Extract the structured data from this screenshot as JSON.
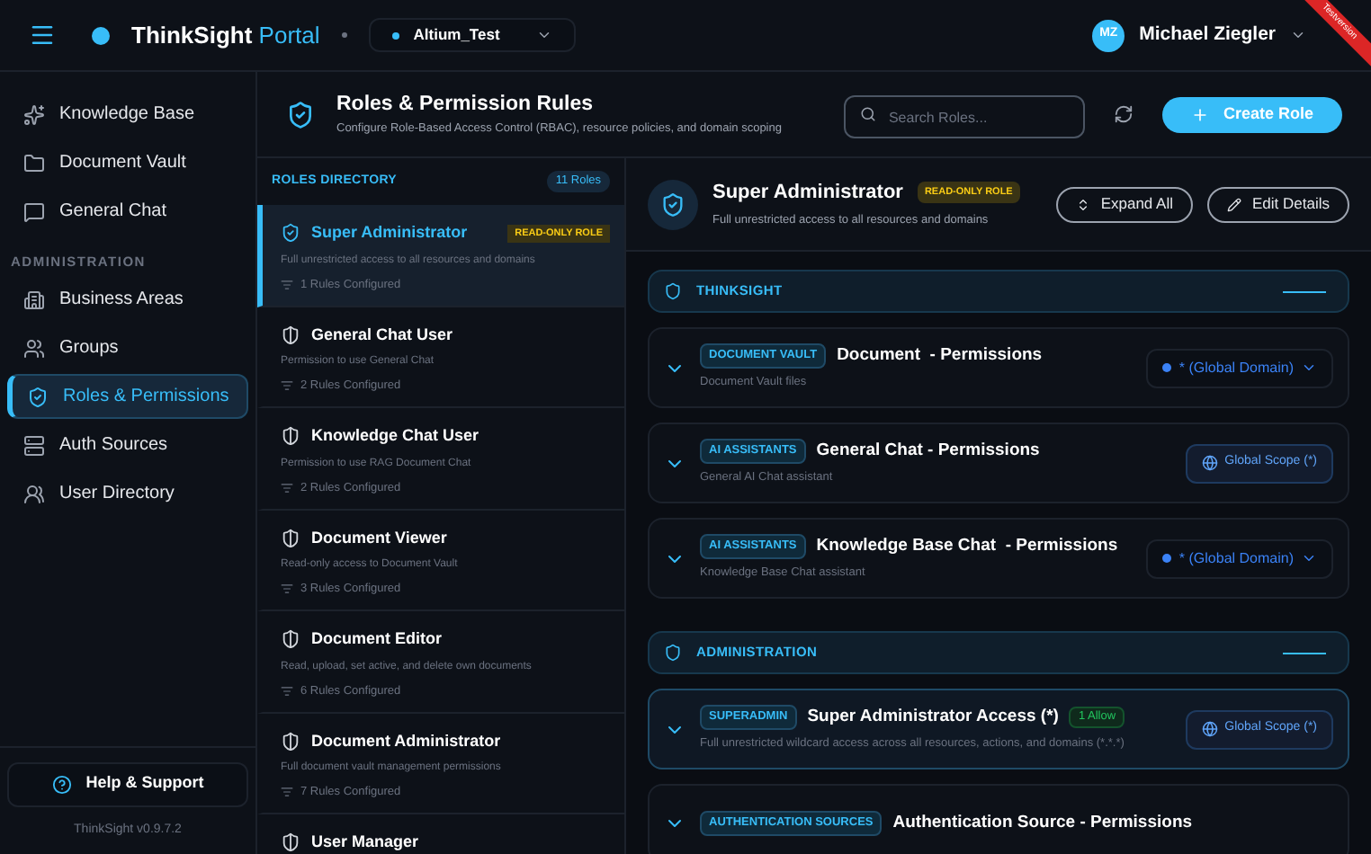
{
  "header": {
    "brand": "ThinkSight",
    "brand_accent": "Portal",
    "workspace": "Altium_Test",
    "user": {
      "initials": "MZ",
      "name": "Michael Ziegler"
    },
    "ribbon": "Testversion"
  },
  "sidebar": {
    "items": [
      {
        "label": "Knowledge Base",
        "selected": false
      },
      {
        "label": "Document Vault",
        "selected": false
      },
      {
        "label": "General Chat",
        "selected": false
      }
    ],
    "section": "ADMINISTRATION",
    "admin_items": [
      {
        "label": "Business Areas",
        "selected": false
      },
      {
        "label": "Groups",
        "selected": false
      },
      {
        "label": "Roles & Permissions",
        "selected": true
      },
      {
        "label": "Auth Sources",
        "selected": false
      },
      {
        "label": "User Directory",
        "selected": false
      }
    ],
    "help": "Help & Support",
    "version": "ThinkSight v0.9.7.2"
  },
  "page": {
    "title": "Roles & Permission Rules",
    "subtitle": "Configure Role-Based Access Control (RBAC), resource policies, and domain scoping",
    "search": {
      "placeholder": "Search Roles..."
    },
    "create_button": "Create Role"
  },
  "roles_directory": {
    "title": "ROLES DIRECTORY",
    "count": "11 Roles",
    "roles": [
      {
        "name": "Super Administrator",
        "badge": "READ-ONLY ROLE",
        "description": "Full unrestricted access to all resources and domains",
        "rules": "1 Rules Configured",
        "selected": true
      },
      {
        "name": "General Chat User",
        "description": "Permission to use General Chat",
        "rules": "2 Rules Configured",
        "selected": false
      },
      {
        "name": "Knowledge Chat User",
        "description": "Permission to use RAG Document Chat",
        "rules": "2 Rules Configured",
        "selected": false
      },
      {
        "name": "Document Viewer",
        "description": "Read-only access to Document Vault",
        "rules": "3 Rules Configured",
        "selected": false
      },
      {
        "name": "Document Editor",
        "description": "Read, upload, set active, and delete own documents",
        "rules": "6 Rules Configured",
        "selected": false
      },
      {
        "name": "Document Administrator",
        "description": "Full document vault management permissions",
        "rules": "7 Rules Configured",
        "selected": false
      },
      {
        "name": "User Manager",
        "selected": false
      }
    ]
  },
  "detail": {
    "name": "Super Administrator",
    "badge": "READ-ONLY ROLE",
    "description": "Full unrestricted access to all resources and domains",
    "buttons": [
      "Expand All",
      "Edit Details"
    ],
    "groups": [
      {
        "title": "THINKSIGHT",
        "rules": [
          {
            "tag": "DOCUMENT VAULT",
            "title": "Document  - Permissions",
            "description": "Document Vault files",
            "kind": "select",
            "scope": "* (Global Domain)",
            "selected": false
          },
          {
            "tag": "AI ASSISTANTS",
            "title": "General Chat - Permissions",
            "description": "General AI Chat assistant",
            "kind": "scope",
            "scope": "Global Scope (*)",
            "selected": false
          },
          {
            "tag": "AI ASSISTANTS",
            "title": "Knowledge Base Chat  - Permissions",
            "description": "Knowledge Base Chat assistant",
            "kind": "select",
            "scope": "* (Global Domain)",
            "selected": false
          }
        ]
      },
      {
        "title": "ADMINISTRATION",
        "rules": [
          {
            "tag": "SUPERADMIN",
            "title": "Super Administrator Access (*)",
            "allow": "1 Allow",
            "description": "Full unrestricted wildcard access across all resources, actions, and domains (*.*.*)",
            "kind": "scope",
            "scope": "Global Scope (*)",
            "selected": true
          },
          {
            "tag": "AUTHENTICATION SOURCES",
            "title": "Authentication Source - Permissions",
            "selected": false
          }
        ]
      }
    ]
  }
}
